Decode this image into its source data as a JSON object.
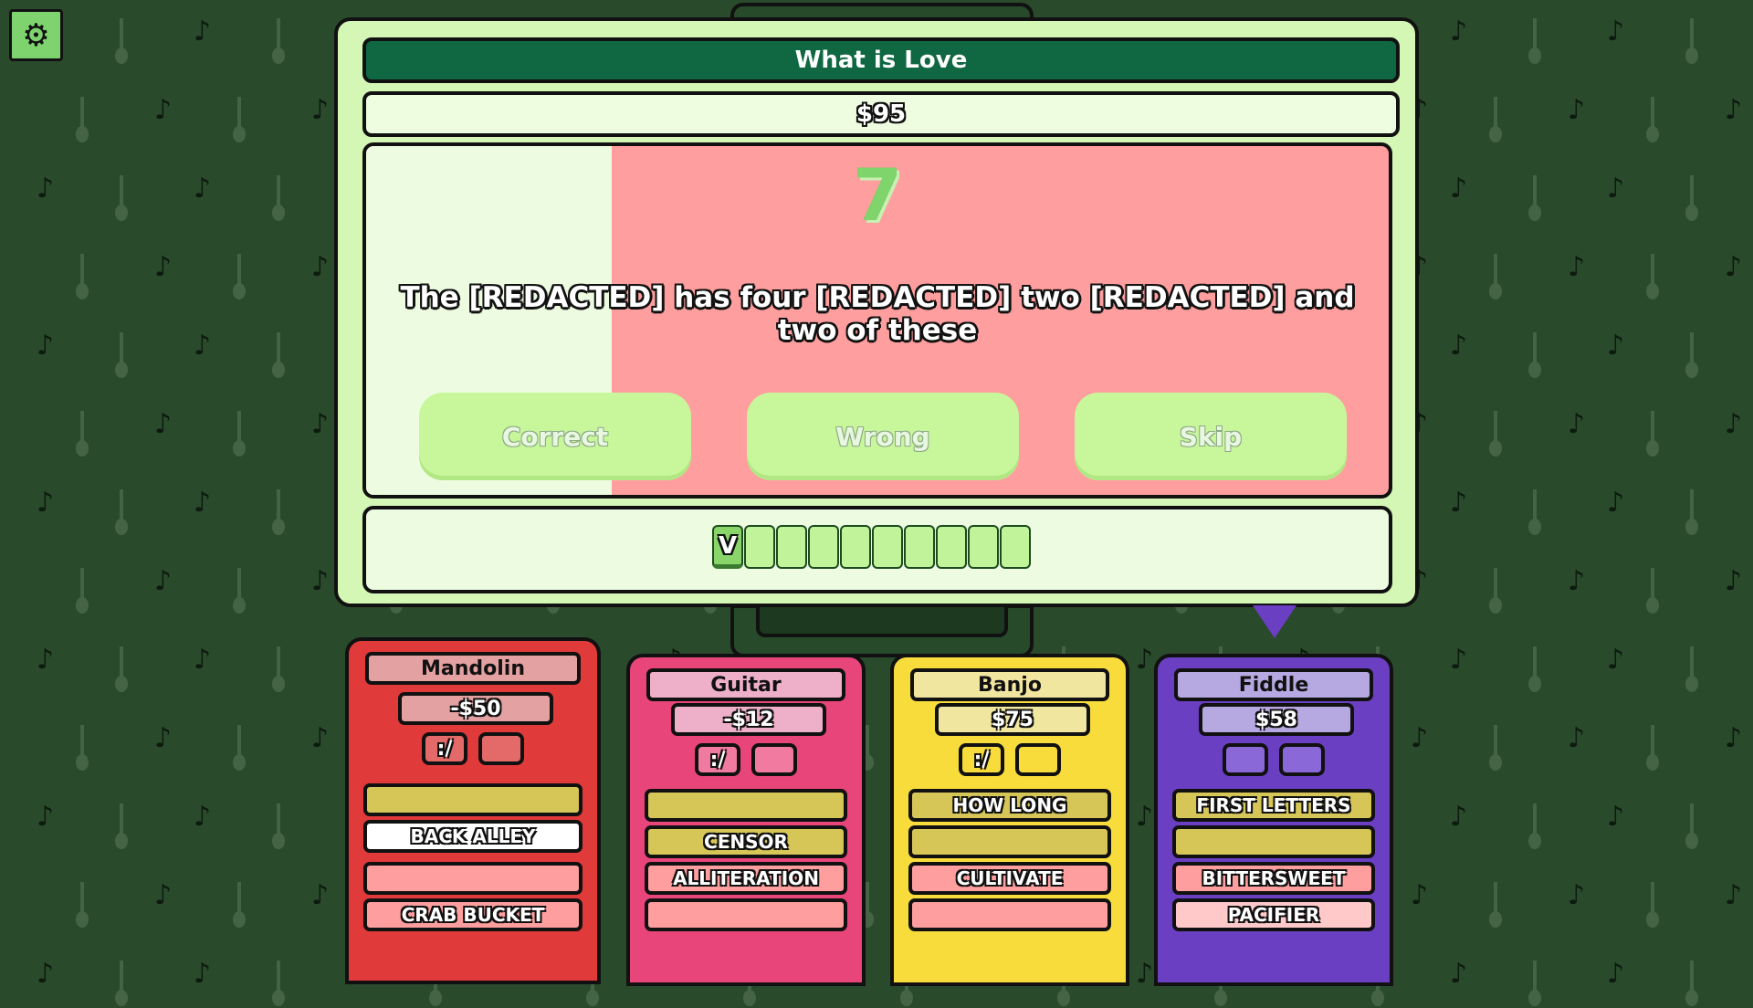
{
  "colors": {
    "background": "#2a4a2c",
    "panel": "#d5f7b6",
    "title_bar": "#106842",
    "question_bg": "#ff9e9e",
    "timer_fill": "#edfce0",
    "button": "#c7f79a",
    "mandolin": "#e03a3a",
    "guitar": "#e8457b",
    "banjo": "#f8dc3c",
    "fiddle": "#6a3fc2"
  },
  "settings": {
    "icon": "gear-icon"
  },
  "round": {
    "title": "What is Love",
    "value": "$95",
    "timer": "7",
    "timer_remaining_fraction": 0.24,
    "clue": "The [REDACTED] has four [REDACTED] two [REDACTED] and two of these"
  },
  "actions": {
    "correct": "Correct",
    "wrong": "Wrong",
    "skip": "Skip"
  },
  "answer": {
    "letters": [
      "V",
      "",
      "",
      "",
      "",
      "",
      "",
      "",
      "",
      ""
    ]
  },
  "players": [
    {
      "name": "Mandolin",
      "score": "-$50",
      "icons": [
        ":/",
        ""
      ],
      "categories": [
        "",
        "BACK ALLEY",
        "",
        "CRAB BUCKET"
      ]
    },
    {
      "name": "Guitar",
      "score": "-$12",
      "icons": [
        ":/",
        ""
      ],
      "categories": [
        "",
        "CENSOR",
        "ALLITERATION",
        ""
      ]
    },
    {
      "name": "Banjo",
      "score": "$75",
      "icons": [
        ":/",
        ""
      ],
      "categories": [
        "HOW LONG",
        "",
        "CULTIVATE",
        ""
      ]
    },
    {
      "name": "Fiddle",
      "score": "$58",
      "icons": [
        "",
        ""
      ],
      "categories": [
        "FIRST LETTERS",
        "",
        "BITTERSWEET",
        "PACIFIER"
      ]
    }
  ]
}
